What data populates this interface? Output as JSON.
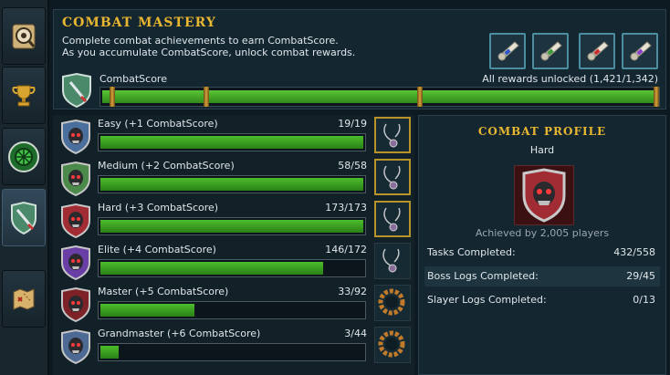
{
  "header": {
    "title": "COMBAT MASTERY",
    "desc_line1": "Complete combat achievements to earn CombatScore.",
    "desc_line2": "As you accumulate CombatScore, unlock combat rewards.",
    "combatscore_label": "CombatScore",
    "rewards_status": "All rewards unlocked (1,421/1,342)",
    "progress_fraction": 1.0,
    "rewards": [
      {
        "icon": "scroll-icon",
        "ribbon": "#2f55c9"
      },
      {
        "icon": "scroll-icon",
        "ribbon": "#3c9a3a"
      },
      {
        "icon": "scroll-icon",
        "ribbon": "#c9302f"
      },
      {
        "icon": "scroll-icon",
        "ribbon": "#8a3fc9"
      }
    ]
  },
  "sidebar": {
    "tabs": [
      {
        "icon": "eye-scroll-icon"
      },
      {
        "icon": "trophy-icon"
      },
      {
        "icon": "green-orb-icon"
      },
      {
        "icon": "combat-shield-icon",
        "active": true
      },
      {
        "icon": "map-scroll-icon"
      }
    ]
  },
  "tiers": [
    {
      "label": "Easy (+1 CombatScore)",
      "count": "19/19",
      "completed": 19,
      "total": 19,
      "color": "#4a6f9c",
      "reward_icon": "amulet-icon"
    },
    {
      "label": "Medium (+2 CombatScore)",
      "count": "58/58",
      "completed": 58,
      "total": 58,
      "color": "#4b8a4a",
      "reward_icon": "amulet-icon"
    },
    {
      "label": "Hard (+3 CombatScore)",
      "count": "173/173",
      "completed": 173,
      "total": 173,
      "color": "#a12c34",
      "reward_icon": "amulet-icon"
    },
    {
      "label": "Elite (+4 CombatScore)",
      "count": "146/172",
      "completed": 146,
      "total": 172,
      "color": "#6a3fa5",
      "reward_icon": "amulet-icon"
    },
    {
      "label": "Master (+5 CombatScore)",
      "count": "33/92",
      "completed": 33,
      "total": 92,
      "color": "#7d2226",
      "reward_icon": "ring-icon"
    },
    {
      "label": "Grandmaster (+6 CombatScore)",
      "count": "3/44",
      "completed": 3,
      "total": 44,
      "color": "#4d6a95",
      "reward_icon": "ring-icon"
    }
  ],
  "profile": {
    "title": "COMBAT PROFILE",
    "tier": "Hard",
    "achieved": "Achieved by 2,005 players",
    "stats": [
      {
        "label": "Tasks Completed:",
        "value": "432/558"
      },
      {
        "label": "Boss Logs Completed:",
        "value": "29/45"
      },
      {
        "label": "Slayer Logs Completed:",
        "value": "0/13"
      }
    ]
  },
  "colors": {
    "accent_gold": "#e8b630",
    "progress_green": "#4bbd2c"
  }
}
